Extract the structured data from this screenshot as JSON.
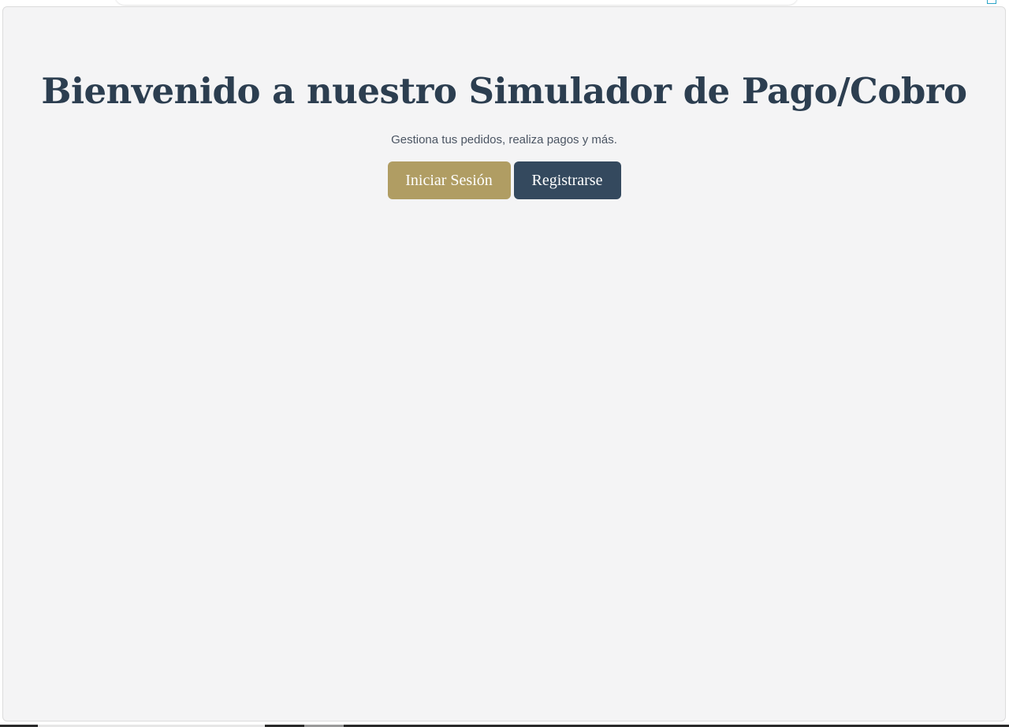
{
  "hero": {
    "title": "Bienvenido a nuestro Simulador de Pago/Cobro",
    "subtitle": "Gestiona tus pedidos, realiza pagos y más.",
    "login_label": "Iniciar Sesión",
    "register_label": "Registrarse"
  },
  "colors": {
    "title": "#2c3e50",
    "login_button": "#b09d63",
    "register_button": "#34495e",
    "page_background": "#f4f4f5"
  }
}
